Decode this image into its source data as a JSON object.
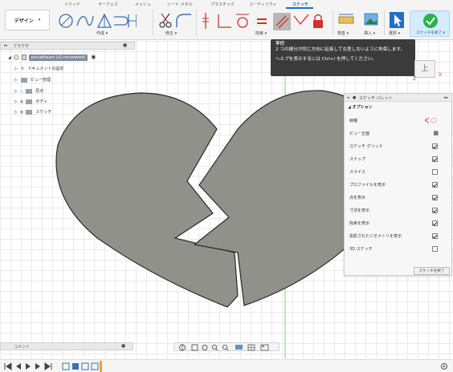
{
  "ribbon": {
    "tabs": [
      "ソリッド",
      "サーフェス",
      "メッシュ",
      "シート メタル",
      "プラスチック",
      "ユーティリティ",
      "スケッチ"
    ],
    "active_tab": "スケッチ",
    "workspace_button": "デザイン",
    "group_labels": {
      "create": "作成",
      "modify": "修正",
      "constraints": "拘束",
      "inspect": "検査",
      "insert": "挿入",
      "select": "選択"
    },
    "finish_button": "スケッチを終了"
  },
  "browser": {
    "title": "ブラウザ",
    "root": "pincetheart (v1-recovered)",
    "items": [
      "ドキュメントの設定",
      "ビュー管理",
      "原点",
      "ボディ",
      "スケッチ"
    ]
  },
  "tooltip": {
    "title": "平行",
    "body": "2 つの線分が同じ方向に延長して交差しないように拘束します。",
    "help": "ヘルプを表示するには Ctrl+/ を押してください。"
  },
  "viewcube": {
    "face": "上",
    "axis_z": "Z",
    "axis_x": "X"
  },
  "sketch_palette": {
    "title": "スケッチ パレット",
    "section": "オプション",
    "options": [
      {
        "label": "線種",
        "type": "linetype"
      },
      {
        "label": "ビュー正面",
        "type": "icon"
      },
      {
        "label": "スケッチ グリッド",
        "checked": true
      },
      {
        "label": "スナップ",
        "checked": true
      },
      {
        "label": "スライス",
        "checked": false
      },
      {
        "label": "プロファイルを表示",
        "checked": true
      },
      {
        "label": "点を表示",
        "checked": true
      },
      {
        "label": "寸法を表示",
        "checked": true
      },
      {
        "label": "拘束を表示",
        "checked": true
      },
      {
        "label": "投影されたジオメトリを表示",
        "checked": true
      },
      {
        "label": "3D スケッチ",
        "checked": false
      }
    ],
    "finish_label": "スケッチを終了"
  },
  "comment_bar": {
    "label": "コメント"
  },
  "colors": {
    "accent": "#0a74d6",
    "heart_fill": "#8f918a",
    "finish_green": "#2bb24c",
    "tooltip_bg": "#3b3b3b"
  }
}
